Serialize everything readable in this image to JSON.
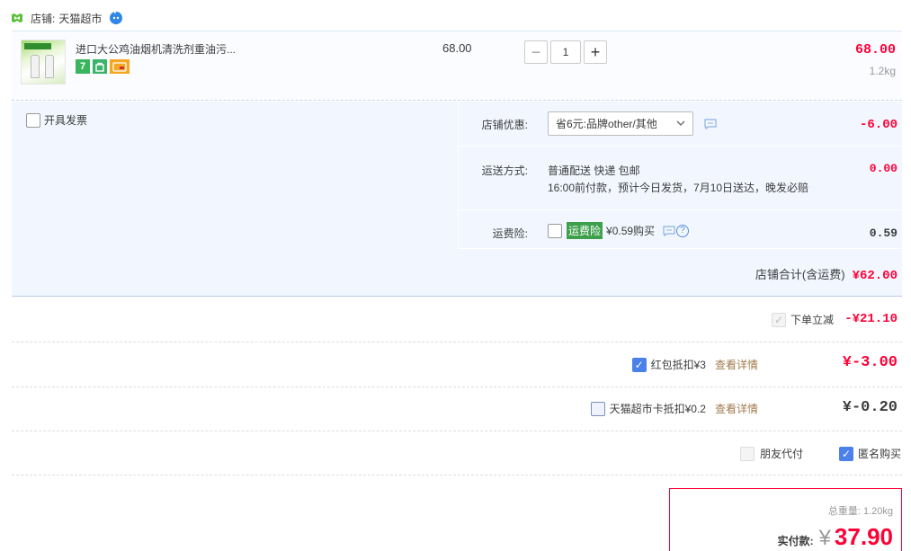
{
  "shop": {
    "label": "店铺:",
    "name": "天猫超市",
    "icons": [
      "shop-flag-icon",
      "wangwang-chat-icon"
    ]
  },
  "item": {
    "title": "进口大公鸡油烟机清洗剂重油污...",
    "unit_price": "68.00",
    "quantity": "1",
    "minus_label": "−",
    "plus_label": "+",
    "total": "68.00",
    "weight": "1.2kg",
    "badges": [
      "7",
      "bag-icon",
      "card-icon"
    ]
  },
  "invoice": {
    "label": "开具发票",
    "checked": false
  },
  "shop_promo": {
    "label": "店铺优惠:",
    "selected": "省6元:品牌other/其他",
    "amount": "-6.00"
  },
  "shipping": {
    "label": "运送方式:",
    "line1": "普通配送 快递 包邮",
    "line2": "16:00前付款，预计今日发货，7月10日送达，晚发必赔",
    "amount": "0.00"
  },
  "shipping_insurance": {
    "label": "运费险:",
    "tag": "运费险",
    "price": "¥0.59购买",
    "amount": "0.59",
    "help": "?"
  },
  "shop_total": {
    "label": "店铺合计(含运费)",
    "value": "¥62.00"
  },
  "discounts": {
    "instant_label": "下单立减",
    "instant_amount": "-¥21.10",
    "instant_mark": "✓",
    "redpacket_label": "红包抵扣¥3",
    "redpacket_link": "查看详情",
    "redpacket_amount": "¥-3.00",
    "redpacket_mark": "✓",
    "tmcard_label": "天猫超市卡抵扣¥0.2",
    "tmcard_link": "查看详情",
    "tmcard_amount": "¥-0.20"
  },
  "options": {
    "friend_pay_label": "朋友代付",
    "anonymous_label": "匿名购买",
    "anonymous_mark": "✓"
  },
  "payment": {
    "weight_label": "总重量:",
    "weight_value": "1.20kg",
    "pay_label": "实付款:",
    "currency": "¥",
    "value": "37.90"
  },
  "colors": {
    "accent_red": "#ff0036",
    "checkbox_blue": "#4c80ea",
    "panel_bg": "#f2f7ff",
    "insurance_green": "#3fa04c",
    "link_brown": "#a07a4c"
  }
}
